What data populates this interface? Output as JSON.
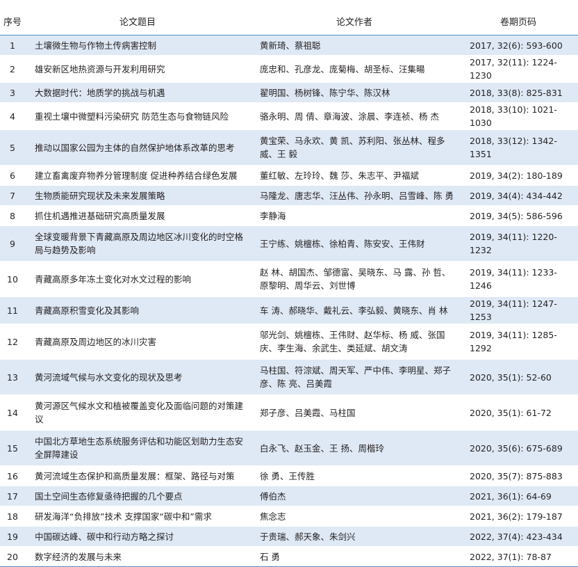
{
  "headers": {
    "no": "序号",
    "title": "论文题目",
    "authors": "论文作者",
    "volume": "卷期页码"
  },
  "rows": [
    {
      "no": "1",
      "title": "土壤微生物与作物土传病害控制",
      "authors": "黄新琦、蔡祖聪",
      "volume": "2017, 32(6): 593-600"
    },
    {
      "no": "2",
      "title": "雄安新区地热资源与开发利用研究",
      "authors": "庞忠和、孔彦龙、庞菊梅、胡圣标、汪集暘",
      "volume": "2017, 32(11): 1224-1230"
    },
    {
      "no": "3",
      "title": "大数据时代：地质学的挑战与机遇",
      "authors": "翟明国、杨树锋、陈宁华、陈汉林",
      "volume": "2018, 33(8): 825-831"
    },
    {
      "no": "4",
      "title": "重视土壤中微塑料污染研究 防范生态与食物链风险",
      "authors": "骆永明、周 倩、章海波、涂晨、李连祯、杨 杰",
      "volume": "2018, 33(10): 1021-1030"
    },
    {
      "no": "5",
      "title": "推动以国家公园为主体的自然保护地体系改革的思考",
      "authors": "黄宝荣、马永欢、黄 凯、苏利阳、张丛林、程多威、王 毅",
      "volume": "2018, 33(12): 1342-1351"
    },
    {
      "no": "6",
      "title": "建立畜禽废弃物养分管理制度 促进种养结合绿色发展",
      "authors": "董红敏、左玲玲、魏 莎、朱志平、尹福斌",
      "volume": "2019, 34(2): 180-189"
    },
    {
      "no": "7",
      "title": "生物质能研究现状及未来发展策略",
      "authors": "马隆龙、唐志华、汪丛伟、孙永明、吕雪峰、陈 勇",
      "volume": "2019, 34(4): 434-442"
    },
    {
      "no": "8",
      "title": "抓住机遇推进基础研究高质量发展",
      "authors": "李静海",
      "volume": "2019, 34(5): 586-596"
    },
    {
      "no": "9",
      "title": "全球变暖背景下青藏高原及周边地区冰川变化的时空格局与趋势及影响",
      "authors": "王宁练、姚檀栋、徐柏青、陈安安、王伟财",
      "volume": "2019, 34(11): 1220-1232"
    },
    {
      "no": "10",
      "title": "青藏高原多年冻土变化对水文过程的影响",
      "authors": "赵 林、胡国杰、邹德富、吴晓东、马 露、孙 哲、原黎明、周华云、刘世博",
      "volume": "2019, 34(11): 1233-1246"
    },
    {
      "no": "11",
      "title": "青藏高原积雪变化及其影响",
      "authors": "车 涛、郝晓华、戴礼云、李弘毅、黄晓东、肖 林",
      "volume": "2019, 34(11): 1247-1253"
    },
    {
      "no": "12",
      "title": "青藏高原及周边地区的冰川灾害",
      "authors": "邬光剑、姚檀栋、王伟财、赵华标、杨 威、张国庆、李生海、余武生、类延斌、胡文涛",
      "volume": "2019, 34(11): 1285-1292"
    },
    {
      "no": "13",
      "title": "黄河流域气候与水文变化的现状及思考",
      "authors": "马柱国、符淙斌、周天军、严中伟、李明星、郑子彦、陈 亮、吕美霞",
      "volume": "2020, 35(1): 52-60"
    },
    {
      "no": "14",
      "title": "黄河源区气候水文和植被覆盖变化及面临问题的对策建议",
      "authors": "郑子彦、吕美霞、马柱国",
      "volume": "2020, 35(1): 61-72"
    },
    {
      "no": "15",
      "title": "中国北方草地生态系统服务评估和功能区划助力生态安全屏障建设",
      "authors": "白永飞、赵玉金、王 扬、周楷玲",
      "volume": "2020, 35(6): 675-689"
    },
    {
      "no": "16",
      "title": "黄河流域生态保护和高质量发展：框架、路径与对策",
      "authors": "徐 勇、王传胜",
      "volume": "2020, 35(7): 875-883"
    },
    {
      "no": "17",
      "title": "国土空间生态修复亟待把握的几个要点",
      "authors": "傅伯杰",
      "volume": "2021, 36(1): 64-69"
    },
    {
      "no": "18",
      "title": "研发海洋“负排放”技术 支撑国家“碳中和”需求",
      "authors": "焦念志",
      "volume": "2021, 36(2): 179-187"
    },
    {
      "no": "19",
      "title": "中国碳达峰、碳中和行动方略之探讨",
      "authors": "于贵瑞、郝天象、朱剑兴",
      "volume": "2022, 37(4): 423-434"
    },
    {
      "no": "20",
      "title": "数字经济的发展与未来",
      "authors": "石 勇",
      "volume": "2022, 37(1): 78-87"
    }
  ]
}
